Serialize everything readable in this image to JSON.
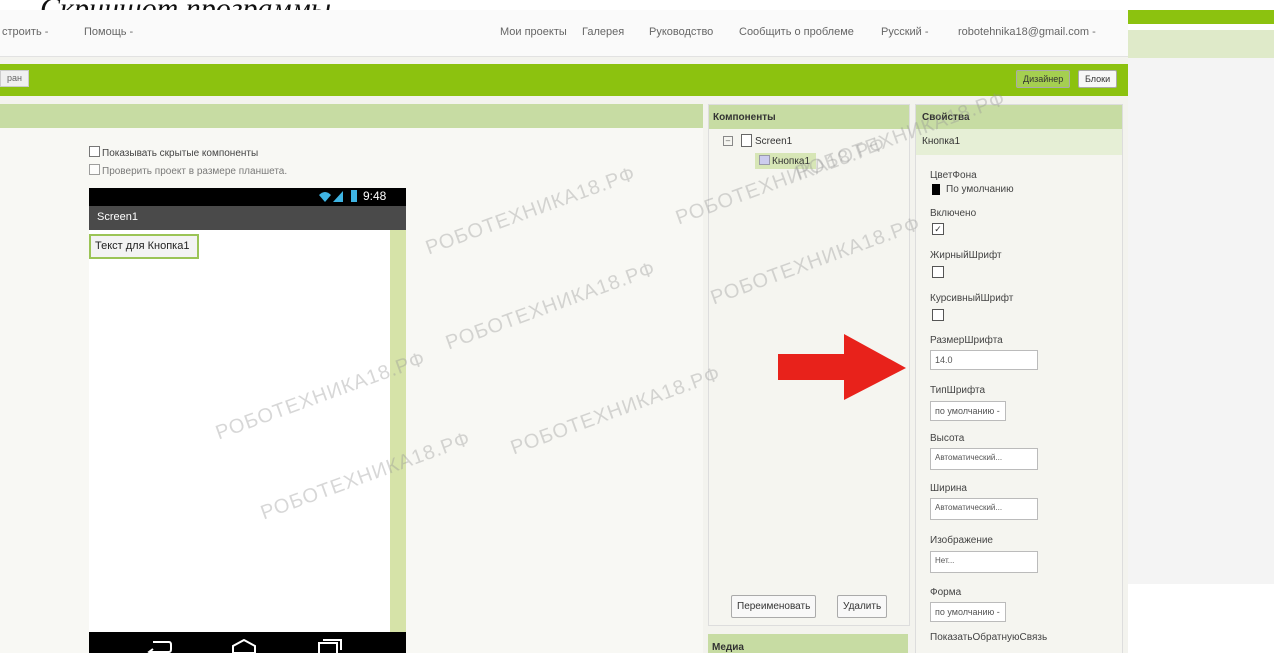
{
  "caption": "Скриншот программы",
  "menu": {
    "build": "строить -",
    "help": "Помощь -",
    "my_projects": "Мои проекты",
    "gallery": "Галерея",
    "guide": "Руководство",
    "report": "Сообщить о проблеме",
    "language": "Русский -",
    "account": "robotehnika18@gmail.com -"
  },
  "toolbar": {
    "left_tab": "ран",
    "designer": "Дизайнер",
    "blocks": "Блоки"
  },
  "viewer": {
    "show_hidden": "Показывать скрытые компоненты",
    "tablet_preview": "Проверить проект в размере планшета."
  },
  "phone": {
    "time": "9:48",
    "screen_title": "Screen1",
    "button_text": "Текст для Кнопка1"
  },
  "components": {
    "header": "Компоненты",
    "tree": {
      "root": "Screen1",
      "child": "Кнопка1"
    },
    "rename": "Переименовать",
    "delete": "Удалить",
    "media": "Медиа"
  },
  "properties": {
    "header": "Свойства",
    "component": "Кнопка1",
    "bg_label": "ЦветФона",
    "bg_value": "По умолчанию",
    "enabled_label": "Включено",
    "enabled": true,
    "bold_label": "ЖирныйШрифт",
    "bold": false,
    "italic_label": "КурсивныйШрифт",
    "italic": false,
    "fontsize_label": "РазмерШрифта",
    "fontsize_value": "14.0",
    "fonttype_label": "ТипШрифта",
    "fonttype_value": "по умолчанию -",
    "height_label": "Высота",
    "height_value": "Автоматический...",
    "width_label": "Ширина",
    "width_value": "Автоматический...",
    "image_label": "Изображение",
    "image_value": "Нет...",
    "shape_label": "Форма",
    "shape_value": "по умолчанию -",
    "feedback_label": "ПоказатьОбратнуюСвязь"
  },
  "watermark": "РОБОТЕХНИКА18.РФ",
  "colors": {
    "accent_green": "#8cc20f",
    "panel_header": "#c7dca3",
    "arrow_red": "#e8221b"
  }
}
